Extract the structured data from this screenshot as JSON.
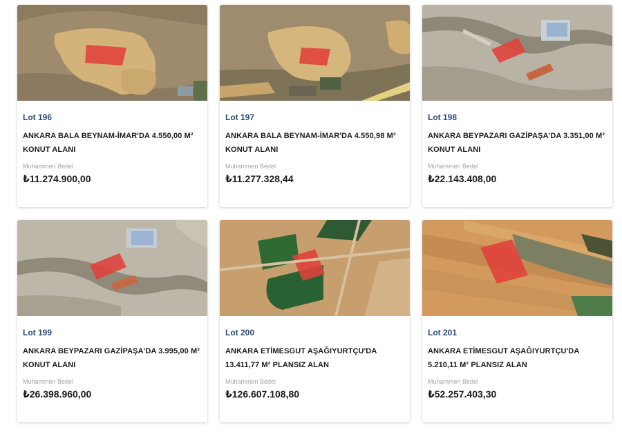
{
  "listings": [
    {
      "lot": "Lot 196",
      "title_line1": "ANKARA BALA BEYNAM-İMAR'DA 4.550,00 M²",
      "title_line2": "KONUT ALANI",
      "price_label": "Muhammen Bedel",
      "price": "₺11.274.900,00",
      "image_icon": "satellite-land-image"
    },
    {
      "lot": "Lot 197",
      "title_line1": "ANKARA BALA BEYNAM-İMAR'DA 4.550,98 M²",
      "title_line2": "KONUT ALANI",
      "price_label": "Muhammen Bedel",
      "price": "₺11.277.328,44",
      "image_icon": "satellite-land-image"
    },
    {
      "lot": "Lot 198",
      "title_line1": "ANKARA BEYPAZARI GAZİPAŞA'DA 3.351,00 M²",
      "title_line2": "KONUT ALANI",
      "price_label": "Muhammen Bedel",
      "price": "₺22.143.408,00",
      "image_icon": "satellite-land-image"
    },
    {
      "lot": "Lot 199",
      "title_line1": "ANKARA BEYPAZARI GAZİPAŞA'DA 3.995,00 M²",
      "title_line2": "KONUT ALANI",
      "price_label": "Muhammen Bedel",
      "price": "₺26.398.960,00",
      "image_icon": "satellite-land-image"
    },
    {
      "lot": "Lot 200",
      "title_line1": "ANKARA ETİMESGUT AŞAĞIYURTÇU'DA",
      "title_line2": "13.411,77 M² PLANSIZ ALAN",
      "price_label": "Muhammen Bedel",
      "price": "₺126.607.108,80",
      "image_icon": "satellite-land-image"
    },
    {
      "lot": "Lot 201",
      "title_line1": "ANKARA ETİMESGUT AŞAĞIYURTÇU'DA",
      "title_line2": "5.210,11 M² PLANSIZ ALAN",
      "price_label": "Muhammen Bedel",
      "price": "₺52.257.403,30",
      "image_icon": "satellite-land-image"
    }
  ],
  "colors": {
    "lot_label": "#2c4a7a",
    "title": "#1b1b1b",
    "muted_label": "#a3a3a3",
    "parcel_highlight": "#e0413a"
  }
}
